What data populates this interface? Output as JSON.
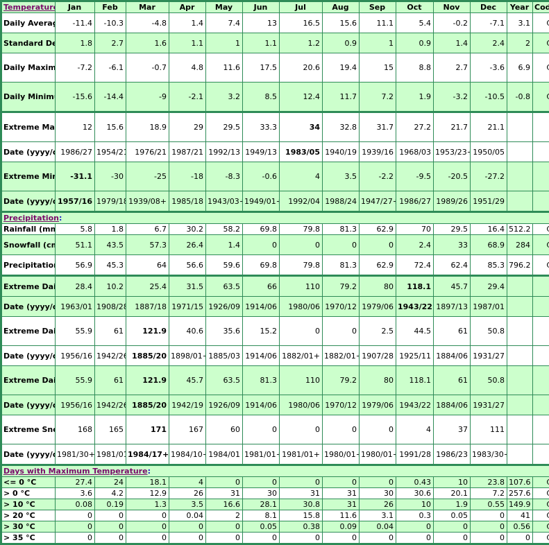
{
  "header": {
    "section_title": "Temperature",
    "columns": [
      "Jan",
      "Feb",
      "Mar",
      "Apr",
      "May",
      "Jun",
      "Jul",
      "Aug",
      "Sep",
      "Oct",
      "Nov",
      "Dec",
      "Year",
      "Code"
    ]
  },
  "sections": [
    {
      "title": "Temperature",
      "rows": [
        {
          "label": "Daily Average (°C)",
          "values": [
            "-11.4",
            "-10.3",
            "-4.8",
            "1.4",
            "7.4",
            "13",
            "16.5",
            "15.6",
            "11.1",
            "5.4",
            "-0.2",
            "-7.1",
            "3.1",
            "C"
          ],
          "bold": []
        },
        {
          "label": "Standard Deviation",
          "values": [
            "1.8",
            "2.7",
            "1.6",
            "1.1",
            "1",
            "1.1",
            "1.2",
            "0.9",
            "1",
            "0.9",
            "1.4",
            "2.4",
            "2",
            "C"
          ],
          "bold": []
        },
        {
          "label": "Daily Maximum (°C)",
          "values": [
            "-7.2",
            "-6.1",
            "-0.7",
            "4.8",
            "11.6",
            "17.5",
            "20.6",
            "19.4",
            "15",
            "8.8",
            "2.7",
            "-3.6",
            "6.9",
            "C"
          ],
          "bold": []
        },
        {
          "label": "Daily Minimum (°C)",
          "values": [
            "-15.6",
            "-14.4",
            "-9",
            "-2.1",
            "3.2",
            "8.5",
            "12.4",
            "11.7",
            "7.2",
            "1.9",
            "-3.2",
            "-10.5",
            "-0.8",
            "C"
          ],
          "bold": []
        },
        {
          "label": "Extreme Maximum (°C)",
          "values": [
            "12",
            "15.6",
            "18.9",
            "29",
            "29.5",
            "33.3",
            "34",
            "32.8",
            "31.7",
            "27.2",
            "21.7",
            "21.1",
            "",
            ""
          ],
          "bold": [
            6
          ]
        },
        {
          "label": "Date (yyyy/dd)",
          "values": [
            "1986/27",
            "1954/21",
            "1976/21",
            "1987/21",
            "1992/13",
            "1949/13",
            "1983/05",
            "1940/19",
            "1939/16",
            "1968/03",
            "1953/23+",
            "1950/05",
            "",
            ""
          ],
          "bold": [
            6
          ]
        },
        {
          "label": "Extreme Minimum (°C)",
          "values": [
            "-31.1",
            "-30",
            "-25",
            "-18",
            "-8.3",
            "-0.6",
            "4",
            "3.5",
            "-2.2",
            "-9.5",
            "-20.5",
            "-27.2",
            "",
            ""
          ],
          "bold": [
            0
          ]
        },
        {
          "label": "Date (yyyy/dd)",
          "values": [
            "1957/16",
            "1979/18",
            "1939/08+",
            "1985/18",
            "1943/03+",
            "1949/01+",
            "1992/04",
            "1988/24",
            "1947/27+",
            "1986/27",
            "1989/26",
            "1951/29",
            "",
            ""
          ],
          "bold": [
            0
          ]
        }
      ]
    },
    {
      "title": "Precipitation",
      "rows": [
        {
          "label": "Rainfall (mm)",
          "values": [
            "5.8",
            "1.8",
            "6.7",
            "30.2",
            "58.2",
            "69.8",
            "79.8",
            "81.3",
            "62.9",
            "70",
            "29.5",
            "16.4",
            "512.2",
            "C"
          ],
          "bold": []
        },
        {
          "label": "Snowfall (cm)",
          "values": [
            "51.1",
            "43.5",
            "57.3",
            "26.4",
            "1.4",
            "0",
            "0",
            "0",
            "0",
            "2.4",
            "33",
            "68.9",
            "284",
            "C"
          ],
          "bold": []
        },
        {
          "label": "Precipitation (mm)",
          "values": [
            "56.9",
            "45.3",
            "64",
            "56.6",
            "59.6",
            "69.8",
            "79.8",
            "81.3",
            "62.9",
            "72.4",
            "62.4",
            "85.3",
            "796.2",
            "C"
          ],
          "bold": []
        },
        {
          "label": "Extreme Daily Rainfall (mm)",
          "values": [
            "28.4",
            "10.2",
            "25.4",
            "31.5",
            "63.5",
            "66",
            "110",
            "79.2",
            "80",
            "118.1",
            "45.7",
            "29.4",
            "",
            ""
          ],
          "bold": [
            9
          ]
        },
        {
          "label": "Date (yyyy/dd)",
          "values": [
            "1963/01",
            "1908/28",
            "1887/18",
            "1971/15",
            "1926/09",
            "1914/06",
            "1980/06",
            "1970/12",
            "1979/06",
            "1943/22",
            "1897/13",
            "1987/01",
            "",
            ""
          ],
          "bold": [
            9
          ]
        },
        {
          "label": "Extreme Daily Snowfall (cm)",
          "values": [
            "55.9",
            "61",
            "121.9",
            "40.6",
            "35.6",
            "15.2",
            "0",
            "0",
            "2.5",
            "44.5",
            "61",
            "50.8",
            "",
            ""
          ],
          "bold": [
            2
          ]
        },
        {
          "label": "Date (yyyy/dd)",
          "values": [
            "1956/16",
            "1942/26",
            "1885/20",
            "1898/01+",
            "1885/03",
            "1914/06",
            "1882/01+",
            "1882/01+",
            "1907/28",
            "1925/11",
            "1884/06",
            "1931/27",
            "",
            ""
          ],
          "bold": [
            2
          ]
        },
        {
          "label": "Extreme Daily Precipitation (mm)",
          "values": [
            "55.9",
            "61",
            "121.9",
            "45.7",
            "63.5",
            "81.3",
            "110",
            "79.2",
            "80",
            "118.1",
            "61",
            "50.8",
            "",
            ""
          ],
          "bold": [
            2
          ]
        },
        {
          "label": "Date (yyyy/dd)",
          "values": [
            "1956/16",
            "1942/26",
            "1885/20",
            "1942/19",
            "1926/09",
            "1914/06",
            "1980/06",
            "1970/12",
            "1979/06",
            "1943/22",
            "1884/06",
            "1931/27",
            "",
            ""
          ],
          "bold": [
            2
          ]
        },
        {
          "label": "Extreme Snow Depth (cm)",
          "values": [
            "168",
            "165",
            "171",
            "167",
            "60",
            "0",
            "0",
            "0",
            "0",
            "4",
            "37",
            "111",
            "",
            ""
          ],
          "bold": [
            2
          ]
        },
        {
          "label": "Date (yyyy/dd)",
          "values": [
            "1981/30+",
            "1981/01",
            "1984/17+",
            "1984/10+",
            "1984/01",
            "1981/01+",
            "1981/01+",
            "1980/01+",
            "1980/01+",
            "1991/28",
            "1986/23",
            "1983/30+",
            "",
            ""
          ],
          "bold": [
            2
          ]
        }
      ]
    },
    {
      "title": "Days with Maximum Temperature",
      "rows": [
        {
          "label": "<= 0 °C",
          "values": [
            "27.4",
            "24",
            "18.1",
            "4",
            "0",
            "0",
            "0",
            "0",
            "0",
            "0.43",
            "10",
            "23.8",
            "107.6",
            "C"
          ],
          "bold": []
        },
        {
          "label": "> 0 °C",
          "values": [
            "3.6",
            "4.2",
            "12.9",
            "26",
            "31",
            "30",
            "31",
            "31",
            "30",
            "30.6",
            "20.1",
            "7.2",
            "257.6",
            "C"
          ],
          "bold": []
        },
        {
          "label": "> 10 °C",
          "values": [
            "0.08",
            "0.19",
            "1.3",
            "3.5",
            "16.6",
            "28.1",
            "30.8",
            "31",
            "26",
            "10",
            "1.9",
            "0.55",
            "149.9",
            "C"
          ],
          "bold": []
        },
        {
          "label": "> 20 °C",
          "values": [
            "0",
            "0",
            "0",
            "0.04",
            "2",
            "8.1",
            "15.8",
            "11.6",
            "3.1",
            "0.3",
            "0.05",
            "0",
            "41",
            "C"
          ],
          "bold": []
        },
        {
          "label": "> 30 °C",
          "values": [
            "0",
            "0",
            "0",
            "0",
            "0",
            "0.05",
            "0.38",
            "0.09",
            "0.04",
            "0",
            "0",
            "0",
            "0.56",
            "C"
          ],
          "bold": []
        },
        {
          "label": "> 35 °C",
          "values": [
            "0",
            "0",
            "0",
            "0",
            "0",
            "0",
            "0",
            "0",
            "0",
            "0",
            "0",
            "0",
            "0",
            "C"
          ],
          "bold": []
        }
      ]
    }
  ]
}
